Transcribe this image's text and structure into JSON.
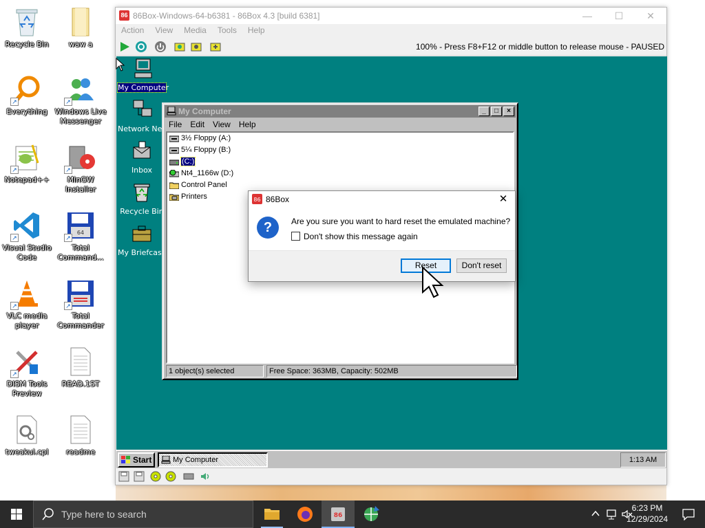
{
  "host_desktop": {
    "icons": [
      {
        "label": "Recycle Bin"
      },
      {
        "label": "waw a"
      },
      {
        "label": "Everything"
      },
      {
        "label": "Windows Live Messenger"
      },
      {
        "label": "Notepad++"
      },
      {
        "label": "MinGW Installer"
      },
      {
        "label": "Visual Studio Code"
      },
      {
        "label": "Total Command..."
      },
      {
        "label": "VLC media player"
      },
      {
        "label": "Total Commander"
      },
      {
        "label": "DISM Tools Preview"
      },
      {
        "label": "READ.1ST"
      },
      {
        "label": "tweakui.cpl"
      },
      {
        "label": "readme"
      }
    ]
  },
  "box_window": {
    "title": "86Box-Windows-64-b6381 - 86Box 4.3 [build 6381]",
    "menu": [
      "Action",
      "View",
      "Media",
      "Tools",
      "Help"
    ],
    "status_text": "100% - Press F8+F12 or middle button to release mouse - PAUSED",
    "vm": {
      "desktop_icons": [
        {
          "label": "My Computer"
        },
        {
          "label": "Network Neighborhood"
        },
        {
          "label": "Inbox"
        },
        {
          "label": "Recycle Bin"
        },
        {
          "label": "My Briefcase"
        }
      ],
      "explorer": {
        "title": "My Computer",
        "menu": [
          "File",
          "Edit",
          "View",
          "Help"
        ],
        "items": [
          {
            "label": "3½ Floppy (A:)"
          },
          {
            "label": "5¼ Floppy (B:)"
          },
          {
            "label": "(C:)"
          },
          {
            "label": "Nt4_1166w (D:)"
          },
          {
            "label": "Control Panel"
          },
          {
            "label": "Printers"
          }
        ],
        "status_left": "1 object(s) selected",
        "status_right": "Free Space: 363MB, Capacity: 502MB"
      },
      "taskbar": {
        "start_label": "Start",
        "task_label": "My Computer",
        "clock": "1:13 AM"
      }
    }
  },
  "dialog": {
    "title": "86Box",
    "message": "Are you sure you want to hard reset the emulated machine?",
    "checkbox_label": "Don't show this message again",
    "checkbox_checked": false,
    "reset_label": "Reset",
    "dont_reset_label": "Don't reset"
  },
  "host_taskbar": {
    "search_placeholder": "Type here to search",
    "time": "6:23 PM",
    "date": "12/29/2024"
  },
  "colors": {
    "vm_teal": "#008080",
    "win95_gray": "#c0c0c0",
    "dialog_accent": "#0078d7"
  }
}
